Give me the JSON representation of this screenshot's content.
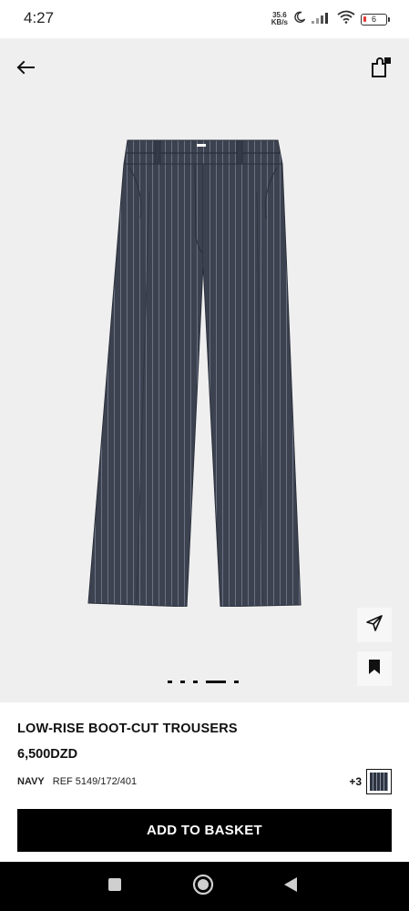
{
  "status_bar": {
    "time": "4:27",
    "net_speed_value": "35.6",
    "net_speed_unit": "KB/s",
    "battery_level": "6"
  },
  "gallery": {
    "page_count": 5,
    "active_page": 4
  },
  "product": {
    "name": "LOW-RISE BOOT-CUT TROUSERS",
    "price": "6,500DZD",
    "color_name": "NAVY",
    "reference": "REF 5149/172/401",
    "more_colors": "+3",
    "swatch_color": "#2e3440"
  },
  "actions": {
    "add_to_basket": "ADD TO BASKET"
  },
  "icons": {
    "back": "arrow-left-icon",
    "bag": "shopping-bag-icon",
    "share": "send-icon",
    "save": "bookmark-icon"
  }
}
